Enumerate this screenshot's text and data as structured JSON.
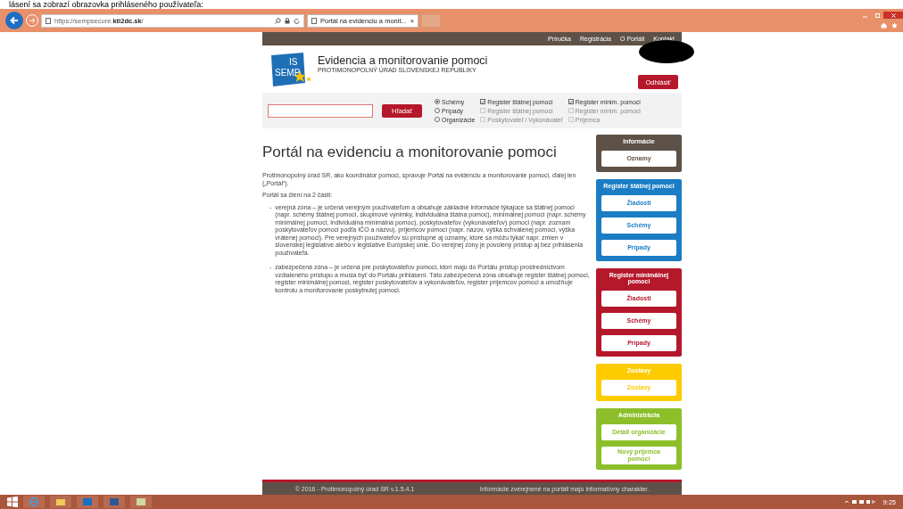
{
  "caption": "lásení sa zobrazí obrazovka prihláseného používateľa:",
  "browser": {
    "address": "https://sempsecure.**kti2dc.sk**/",
    "tabs": [
      {
        "title": "Portál na evidenciu a monit...",
        "close": "×",
        "selected": true
      }
    ]
  },
  "nav": [
    "Príručka",
    "Registrácia",
    "O Portáli",
    "Kontakt"
  ],
  "logo": {
    "lines": [
      "IS",
      "SEMP"
    ]
  },
  "site_title": "Evidencia a monitorovanie pomoci",
  "site_subtitle": "PROTIMONOPOLNÝ ÚRAD SLOVENSKEJ REPUBLIKY",
  "logout": "Odhlásiť",
  "search": {
    "button": "Hľadať",
    "rows": [
      {
        "radio": {
          "label": "Schémy",
          "selected": true
        },
        "checks": [
          {
            "label": "Register štátnej pomoci",
            "checked": true,
            "disabled": false
          },
          {
            "label": "Register minim. pomoci",
            "checked": true,
            "disabled": false
          }
        ]
      },
      {
        "radio": {
          "label": "Prípady",
          "selected": false
        },
        "checks": [
          {
            "label": "Register štátnej pomoci",
            "checked": false,
            "disabled": true
          },
          {
            "label": "Register minim. pomoci",
            "checked": false,
            "disabled": true
          }
        ]
      },
      {
        "radio": {
          "label": "Organizácie",
          "selected": false
        },
        "checks": [
          {
            "label": "Poskytovateľ / Vykonávateľ",
            "checked": false,
            "disabled": true
          },
          {
            "label": "Príjemca",
            "checked": false,
            "disabled": true
          }
        ]
      }
    ]
  },
  "heading": "Portál na evidenciu a monitorovanie pomoci",
  "paragraphs": [
    "Protimonopolný úrad SR, ako koordinátor pomoci, spravuje Portál na evidenciu a monitorovanie pomoci, ďalej len („Portál“).",
    "Portál sa člení na 2 časti:"
  ],
  "list": [
    {
      "bullet": "-",
      "text": "verejná zóna – je určená verejným používateľom a obsahuje základné informácie týkajúce sa štátnej pomoci (napr. schémy štátnej pomoci, skupinové výnimky, individuálna štátna pomoc), minimálnej pomoci (napr. schémy minimálnej pomoci, individuálna minimálna pomoc), poskytovateľov (vykonávateľov) pomoci (napr. zoznam poskytovateľov pomoci podľa IČO a názvu), príjemcov pomoci (napr. názov, výška schválenej pomoci, výška vrátenej pomoci). Pre verejných používateľov sú prístupné aj oznamy, ktoré sa môžu týkať napr. zmien v slovenskej legislatíve alebo v legislatíve Európskej únie. Do verejnej zóny je povolený prístup aj bez prihlásenia používateľa."
    },
    {
      "bullet": "-",
      "text": "zabezpečená zóna – je určená pre poskytovateľov pomoci, ktorí majú do Portálu prístup prostredníctvom vzdialeného prístupu a musia byť do Portálu prihlásení. Táto zabezpečená zóna obsahuje register štátnej pomoci, register minimálnej pomoci, register poskytovateľov a vykonávateľov, register príjemcov pomoci a umožňuje kontrolu a monitorovanie poskytnutej pomoci."
    }
  ],
  "sidebar": [
    {
      "title": "Informácie",
      "color": "#5e5147",
      "buttons": [
        "Oznamy"
      ]
    },
    {
      "title": "Register štátnej pomoci",
      "color": "#1b7dc4",
      "buttons": [
        "Žiadosti",
        "Schémy",
        "Prípady"
      ]
    },
    {
      "title": "Register minimálnej pomoci",
      "color": "#b5182a",
      "buttons": [
        "Žiadosti",
        "Schémy",
        "Prípady"
      ]
    },
    {
      "title": "Zostavy",
      "color": "#fecb00",
      "buttons": [
        "Zostavy"
      ]
    },
    {
      "title": "Administrácia",
      "color": "#8dbf2b",
      "buttons": [
        "Detail organizácie",
        "Nový príjemca pomoci"
      ]
    }
  ],
  "footer": {
    "left": "© 2016 - Protimonopolný úrad SR v.1.5.4.1",
    "right": "Informácie zverejnené na portáli majú informatívny charakter."
  },
  "taskbar": {
    "time": "9:25"
  }
}
